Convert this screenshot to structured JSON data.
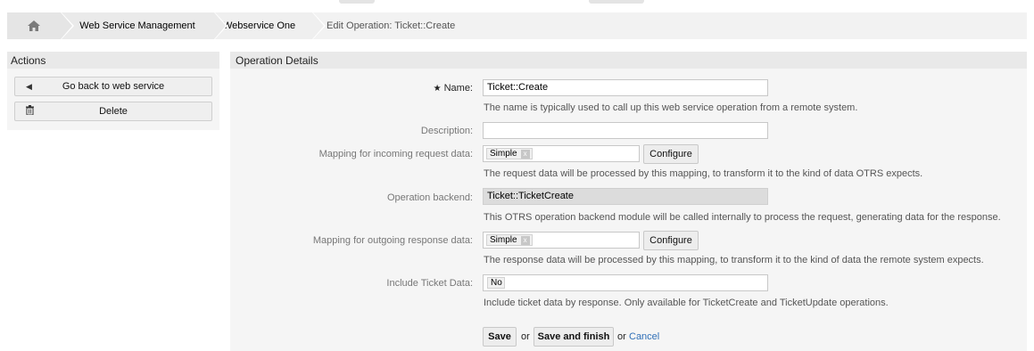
{
  "breadcrumb": {
    "home_icon": "home-icon",
    "items": [
      "Web Service Management",
      "Webservice One",
      "Edit Operation: Ticket::Create"
    ]
  },
  "actions": {
    "title": "Actions",
    "back_label": "Go back to web service",
    "back_icon": "caret-left-icon",
    "delete_label": "Delete",
    "delete_icon": "trash-icon"
  },
  "details": {
    "title": "Operation Details",
    "name": {
      "label": "Name:",
      "value": "Ticket::Create",
      "hint": "The name is typically used to call up this web service operation from a remote system."
    },
    "description": {
      "label": "Description:",
      "value": ""
    },
    "incoming": {
      "label": "Mapping for incoming request data:",
      "tag": "Simple",
      "tag_remove": "x",
      "configure": "Configure",
      "hint": "The request data will be processed by this mapping, to transform it to the kind of data OTRS expects."
    },
    "backend": {
      "label": "Operation backend:",
      "value": "Ticket::TicketCreate",
      "hint": "This OTRS operation backend module will be called internally to process the request, generating data for the response."
    },
    "outgoing": {
      "label": "Mapping for outgoing response data:",
      "tag": "Simple",
      "tag_remove": "x",
      "configure": "Configure",
      "hint": "The response data will be processed by this mapping, to transform it to the kind of data the remote system expects."
    },
    "include_ticket": {
      "label": "Include Ticket Data:",
      "value": "No",
      "hint": "Include ticket data by response. Only available for TicketCreate and TicketUpdate operations."
    },
    "buttons": {
      "save": "Save",
      "or1": "or",
      "save_finish": "Save and finish",
      "or2": "or",
      "cancel": "Cancel"
    }
  },
  "colors": {
    "link": "#2f6fb7",
    "panel": "#f5f5f5",
    "header": "#e9e9e9"
  }
}
